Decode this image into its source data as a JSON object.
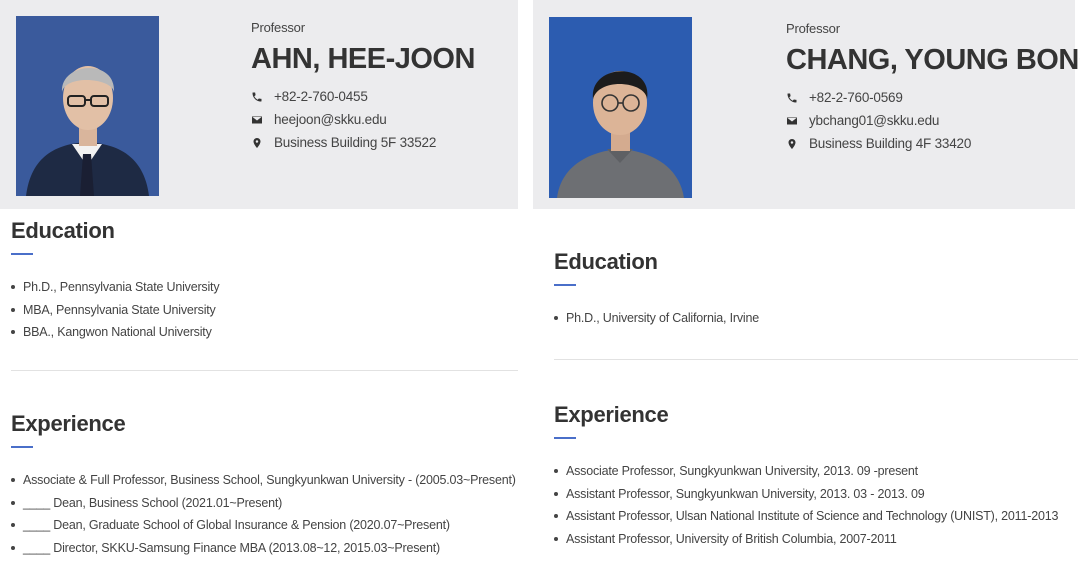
{
  "left": {
    "role": "Professor",
    "name": "AHN, HEE-JOON",
    "phone": "+82-2-760-0455",
    "email": "heejoon@skku.edu",
    "office": "Business Building 5F 33522",
    "education_title": "Education",
    "education": [
      "Ph.D., Pennsylvania State University",
      "MBA, Pennsylvania State University",
      "BBA., Kangwon National University"
    ],
    "experience_title": "Experience",
    "experience": [
      "Associate & Full Professor, Business School, Sungkyunkwan University - (2005.03~Present)",
      "____ Dean, Business School (2021.01~Present)",
      "____ Dean, Graduate School of Global Insurance & Pension (2020.07~Present)",
      "____ Director, SKKU-Samsung Finance MBA (2013.08~12, 2015.03~Present)"
    ]
  },
  "right": {
    "role": "Professor",
    "name": "CHANG, YOUNG BONG",
    "phone": "+82-2-760-0569",
    "email": "ybchang01@skku.edu",
    "office": "Business Building 4F 33420",
    "education_title": "Education",
    "education": [
      "Ph.D., University of California, Irvine"
    ],
    "experience_title": "Experience",
    "experience": [
      "Associate Professor, Sungkyunkwan University, 2013. 09 -present",
      "Assistant Professor, Sungkyunkwan University, 2013. 03 - 2013. 09",
      "Assistant Professor, Ulsan National Institute of Science and Technology (UNIST), 2011-2013",
      "Assistant Professor, University of British Columbia, 2007-2011"
    ]
  },
  "colors": {
    "accent": "#4a6fc9",
    "hero_bg": "#ececee"
  },
  "icons": [
    "phone-icon",
    "mail-icon",
    "location-pin-icon"
  ]
}
